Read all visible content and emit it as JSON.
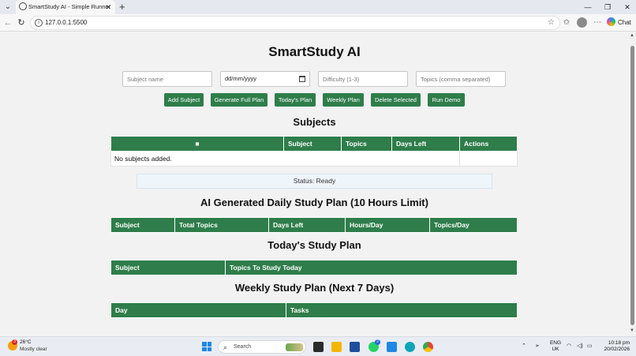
{
  "browser": {
    "tab_title": "SmartStudy AI - Simple Runner",
    "url": "127.0.0.1:5500",
    "chat_label": "Chat"
  },
  "app": {
    "title": "SmartStudy AI",
    "inputs": {
      "subject_placeholder": "Subject name",
      "date_value": "dd/mm/yyyy",
      "difficulty_placeholder": "Difficulty (1-3)",
      "topics_placeholder": "Topics (comma separated)"
    },
    "buttons": [
      "Add Subject",
      "Generate Full Plan",
      "Today's Plan",
      "Weekly Plan",
      "Delete Selected",
      "Run Demo"
    ],
    "subjects": {
      "heading": "Subjects",
      "select_all_symbol": "■",
      "columns": [
        "Subject",
        "Topics",
        "Days Left",
        "Actions"
      ],
      "empty_message": "No subjects added."
    },
    "status": "Status: Ready",
    "daily_plan": {
      "heading": "AI Generated Daily Study Plan (10 Hours Limit)",
      "columns": [
        "Subject",
        "Total Topics",
        "Days Left",
        "Hours/Day",
        "Topics/Day"
      ]
    },
    "today_plan": {
      "heading": "Today's Study Plan",
      "columns": [
        "Subject",
        "Topics To Study Today"
      ]
    },
    "weekly_plan": {
      "heading": "Weekly Study Plan (Next 7 Days)",
      "columns": [
        "Day",
        "Tasks"
      ]
    },
    "accent_color": "#2e7d4a"
  },
  "taskbar": {
    "weather_temp": "26°C",
    "weather_desc": "Mostly clear",
    "weather_badge": "3",
    "search_label": "Search",
    "whatsapp_badge": "2",
    "language": "ENG",
    "region": "UK",
    "time": "10:18 pm",
    "date": "20/02/2026"
  }
}
